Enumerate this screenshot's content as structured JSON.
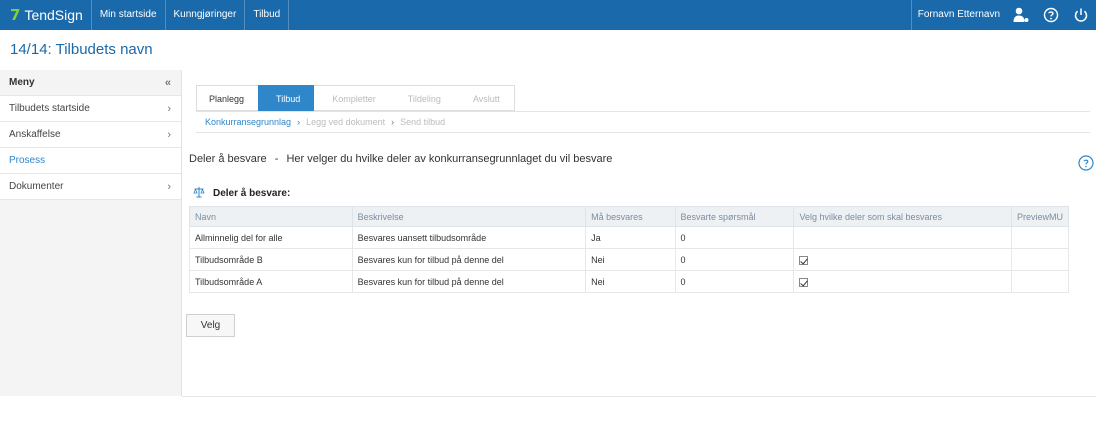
{
  "app": {
    "brand": "TendSign",
    "nav": [
      "Min startside",
      "Kunngjøringer",
      "Tilbud"
    ],
    "user_name": "Fornavn Etternavn",
    "colors": {
      "topbar": "#1a69ab",
      "accent": "#2f86c9",
      "brand_mark": "#7fd13b"
    }
  },
  "page": {
    "title": "14/14: Tilbudets navn"
  },
  "sidebar": {
    "header": "Meny",
    "collapse_icon": "double-chevron-left-icon",
    "items": [
      {
        "label": "Tilbudets startside",
        "has_chevron": true
      },
      {
        "label": "Anskaffelse",
        "has_chevron": true
      },
      {
        "label": "Prosess",
        "active": true
      },
      {
        "label": "Dokumenter",
        "has_chevron": true
      }
    ]
  },
  "steps": [
    {
      "label": "Planlegg",
      "state": "done"
    },
    {
      "label": "Tilbud",
      "state": "active"
    },
    {
      "label": "Kompletter",
      "state": "disabled"
    },
    {
      "label": "Tildeling",
      "state": "disabled"
    },
    {
      "label": "Avslutt",
      "state": "disabled"
    }
  ],
  "breadcrumb": [
    {
      "label": "Konkurransegrunnlag",
      "active": true
    },
    {
      "label": "Legg ved dokument",
      "active": false
    },
    {
      "label": "Send tilbud",
      "active": false
    }
  ],
  "section": {
    "title": "Deler å besvare",
    "separator": "-",
    "description": "Her velger du hvilke deler av konkurransegrunnlaget du vil besvare"
  },
  "table": {
    "title": "Deler å besvare:",
    "columns": [
      "Navn",
      "Beskrivelse",
      "Må besvares",
      "Besvarte spørsmål",
      "Velg hvilke deler som skal besvares",
      "PreviewMU"
    ],
    "rows": [
      {
        "navn": "Allminnelig del for alle",
        "beskrivelse": "Besvares uansett tilbudsområde",
        "ma_besvares": "Ja",
        "besvarte": "0",
        "selected": null
      },
      {
        "navn": "Tilbudsområde B",
        "beskrivelse": "Besvares kun for tilbud på denne del",
        "ma_besvares": "Nei",
        "besvarte": "0",
        "selected": true
      },
      {
        "navn": "Tilbudsområde A",
        "beskrivelse": "Besvares kun for tilbud på denne del",
        "ma_besvares": "Nei",
        "besvarte": "0",
        "selected": true
      }
    ]
  },
  "actions": {
    "velg_label": "Velg"
  }
}
